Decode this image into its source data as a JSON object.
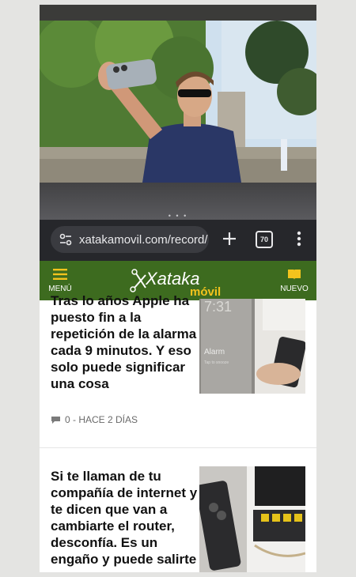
{
  "browser": {
    "url": "xatakamovil.com/record/",
    "tab_count": "70",
    "overflow_dots": "• • •"
  },
  "site": {
    "logo_main": "Xataka",
    "logo_sub": "móvil",
    "menu_label": "MENÚ",
    "nuevo_label": "NUEVO",
    "brand_color": "#3d6b1f",
    "accent_color": "#f3c31d"
  },
  "articles": [
    {
      "headline": "Tras lo años Apple ha puesto fin a la repetición de la alarma cada 9 minutos. Y eso solo puede significar una cosa",
      "meta": "0 - HACE 2 DÍAS",
      "thumb_time": "7:31",
      "thumb_alarm": "Alarm",
      "thumb_sub": "Tap to snooze"
    },
    {
      "headline": "Si te llaman de tu compañía de internet y te dicen que van a cambiarte el router, desconfía. Es un engaño y puede salirte muy"
    }
  ],
  "icons": [
    "tune-icon",
    "plus-icon",
    "tab-switcher-icon",
    "more-vert-icon",
    "menu-icon",
    "book-icon",
    "comment-icon"
  ]
}
